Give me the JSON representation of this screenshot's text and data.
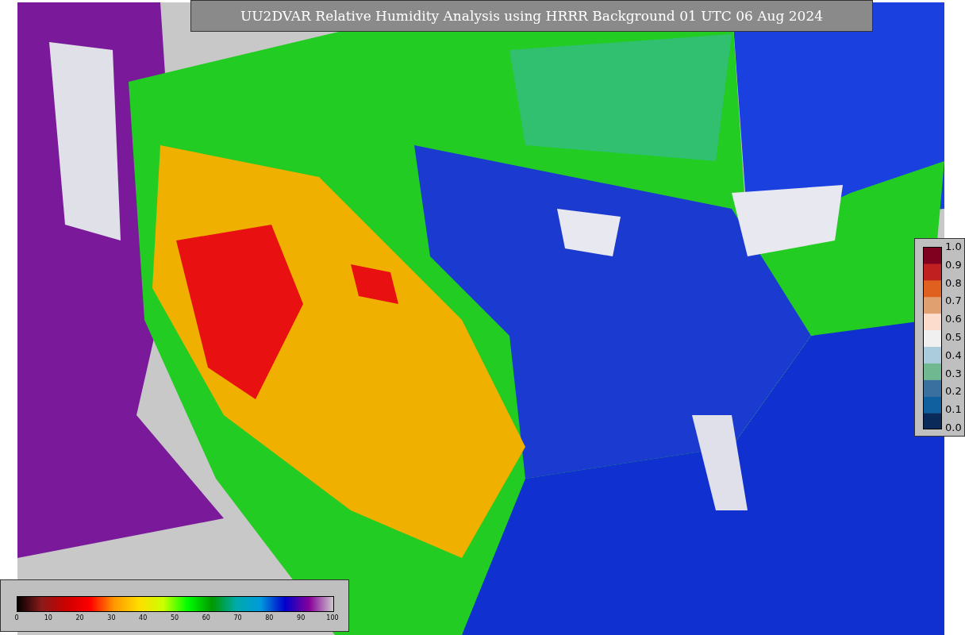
{
  "title": "UU2DVAR Relative Humidity Analysis using HRRR Background 01 UTC 06 Aug 2024",
  "fraction_legend": {
    "ticks": [
      "1.0",
      "0.9",
      "0.8",
      "0.7",
      "0.6",
      "0.5",
      "0.4",
      "0.3",
      "0.2",
      "0.1",
      "0.0"
    ]
  },
  "humidity_legend": {
    "ticks": [
      "0",
      "10",
      "20",
      "30",
      "40",
      "50",
      "60",
      "70",
      "80",
      "90",
      "100"
    ]
  }
}
